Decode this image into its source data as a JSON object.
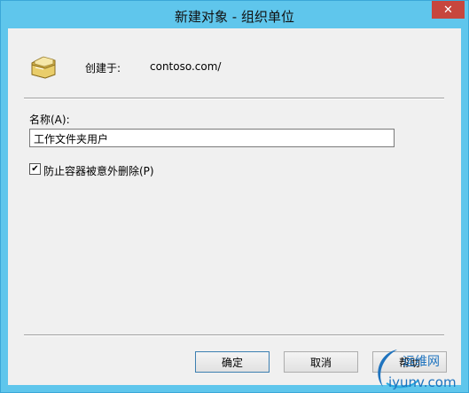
{
  "window": {
    "title": "新建对象 - 组织单位",
    "close_glyph": "✕"
  },
  "icon": "ou-folder-icon",
  "created_in": {
    "label": "创建于:",
    "value": "contoso.com/"
  },
  "name_field": {
    "label": "名称(A):",
    "value": "工作文件夹用户"
  },
  "protect": {
    "label": "防止容器被意外删除(P)",
    "checked": true,
    "check_glyph": "✔"
  },
  "buttons": {
    "ok": "确定",
    "cancel": "取消",
    "help": "帮助"
  },
  "watermark": {
    "cn": "运维网",
    "site": "iyunv.com"
  },
  "colors": {
    "title_bar": "#5fc6ec",
    "close": "#c7463d",
    "client": "#f0f0f0"
  }
}
